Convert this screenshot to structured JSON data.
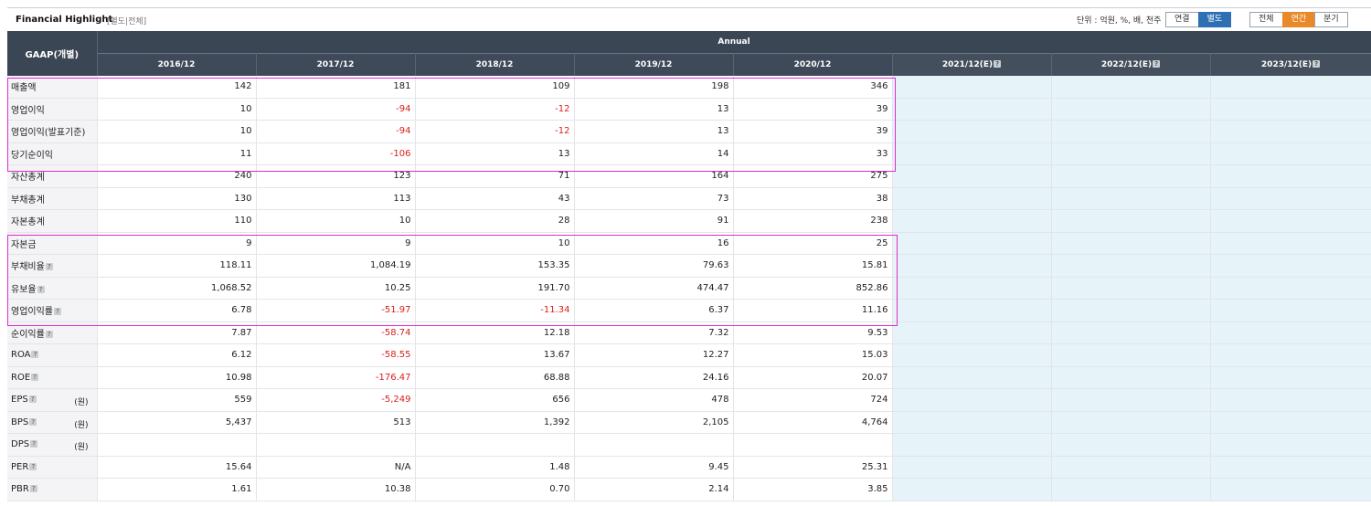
{
  "header": {
    "title": "Financial Highlight",
    "subtitle": "[별도|전체]",
    "unit_text": "단위 : 억원, %, 배, 천주",
    "scope_buttons": [
      "연결",
      "별도"
    ],
    "period_buttons": [
      "전체",
      "연간",
      "분기"
    ],
    "active_scope": "별도",
    "active_period": "연간"
  },
  "table": {
    "row_header": "GAAP(개별)",
    "group_header": "Annual",
    "columns": [
      "2016/12",
      "2017/12",
      "2018/12",
      "2019/12",
      "2020/12",
      "2021/12(E)",
      "2022/12(E)",
      "2023/12(E)"
    ],
    "rows": [
      {
        "label": "매출액",
        "help": false,
        "unit": "",
        "values": [
          "142",
          "181",
          "109",
          "198",
          "346"
        ]
      },
      {
        "label": "영업이익",
        "help": false,
        "unit": "",
        "values": [
          "10",
          "-94",
          "-12",
          "13",
          "39"
        ]
      },
      {
        "label": "영업이익(발표기준)",
        "help": false,
        "unit": "",
        "values": [
          "10",
          "-94",
          "-12",
          "13",
          "39"
        ]
      },
      {
        "label": "당기순이익",
        "help": false,
        "unit": "",
        "values": [
          "11",
          "-106",
          "13",
          "14",
          "33"
        ]
      },
      {
        "label": "자산총계",
        "help": false,
        "unit": "",
        "values": [
          "240",
          "123",
          "71",
          "164",
          "275"
        ]
      },
      {
        "label": "부채총계",
        "help": false,
        "unit": "",
        "values": [
          "130",
          "113",
          "43",
          "73",
          "38"
        ]
      },
      {
        "label": "자본총계",
        "help": false,
        "unit": "",
        "values": [
          "110",
          "10",
          "28",
          "91",
          "238"
        ]
      },
      {
        "label": "자본금",
        "help": false,
        "unit": "",
        "values": [
          "9",
          "9",
          "10",
          "16",
          "25"
        ]
      },
      {
        "label": "부채비율",
        "help": true,
        "unit": "",
        "values": [
          "118.11",
          "1,084.19",
          "153.35",
          "79.63",
          "15.81"
        ]
      },
      {
        "label": "유보율",
        "help": true,
        "unit": "",
        "values": [
          "1,068.52",
          "10.25",
          "191.70",
          "474.47",
          "852.86"
        ]
      },
      {
        "label": "영업이익률",
        "help": true,
        "unit": "",
        "values": [
          "6.78",
          "-51.97",
          "-11.34",
          "6.37",
          "11.16"
        ]
      },
      {
        "label": "순이익률",
        "help": true,
        "unit": "",
        "values": [
          "7.87",
          "-58.74",
          "12.18",
          "7.32",
          "9.53"
        ]
      },
      {
        "label": "ROA",
        "help": true,
        "unit": "",
        "values": [
          "6.12",
          "-58.55",
          "13.67",
          "12.27",
          "15.03"
        ]
      },
      {
        "label": "ROE",
        "help": true,
        "unit": "",
        "values": [
          "10.98",
          "-176.47",
          "68.88",
          "24.16",
          "20.07"
        ]
      },
      {
        "label": "EPS",
        "help": true,
        "unit": "(원)",
        "values": [
          "559",
          "-5,249",
          "656",
          "478",
          "724"
        ]
      },
      {
        "label": "BPS",
        "help": true,
        "unit": "(원)",
        "values": [
          "5,437",
          "513",
          "1,392",
          "2,105",
          "4,764"
        ]
      },
      {
        "label": "DPS",
        "help": true,
        "unit": "(원)",
        "values": [
          "",
          "",
          "",
          "",
          ""
        ]
      },
      {
        "label": "PER",
        "help": true,
        "unit": "",
        "values": [
          "15.64",
          "N/A",
          "1.48",
          "9.45",
          "25.31"
        ]
      },
      {
        "label": "PBR",
        "help": true,
        "unit": "",
        "values": [
          "1.61",
          "10.38",
          "0.70",
          "2.14",
          "3.85"
        ]
      }
    ]
  },
  "colors": {
    "header_bg": "#3a4654",
    "negative": "#d8221b",
    "estimate_bg": "#e6f3f8",
    "highlight": "#e02ad2",
    "active_blue": "#2f6fb3",
    "active_orange": "#e98a2a"
  }
}
